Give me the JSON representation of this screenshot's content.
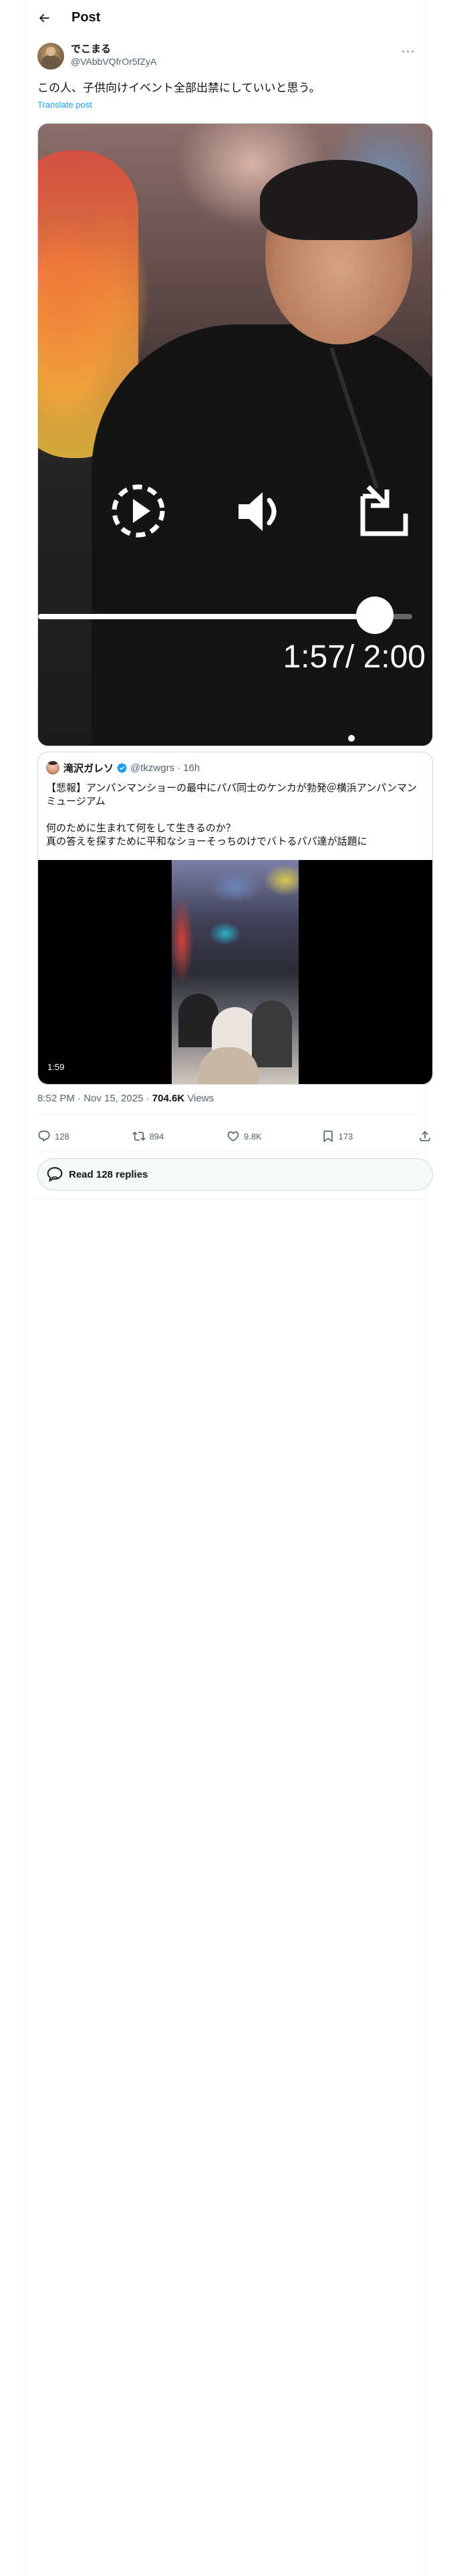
{
  "header": {
    "title": "Post",
    "back_icon": "arrow-left-icon"
  },
  "author": {
    "display_name": "でこまる",
    "handle": "@VAbbVQfrOr5fZyA",
    "more_label": "···"
  },
  "tweet": {
    "text": "この人、子供向けイベント全部出禁にしていいと思う。",
    "translate_label": "Translate post"
  },
  "video": {
    "controls": [
      "replay-icon",
      "volume-icon",
      "fullscreen-exit-icon"
    ],
    "progress": 0.9,
    "time_label": "1:57/ 2:00"
  },
  "quote": {
    "display_name": "滝沢ガレソ",
    "verified": true,
    "handle": "@tkzwgrs",
    "separator": "·",
    "time": "16h",
    "lines": [
      "【悲報】アンパンマンショーの最中にパパ同士のケンカが勃発＠横浜アンパンマンミュージアム",
      "",
      "何のために生まれて何をして生きるのか？",
      "真の答えを探すために平和なショーそっちのけでバトるパパ達が話題に"
    ],
    "video_duration": "1:59"
  },
  "meta": {
    "timestamp": "8:52 PM · Nov 15, 2025",
    "separator": " · ",
    "views_count": "704.6K",
    "views_label": " Views"
  },
  "actions": {
    "replies": "128",
    "reposts": "894",
    "likes": "9.8K",
    "bookmarks": "173"
  },
  "read_replies": {
    "label": "Read 128 replies"
  },
  "colors": {
    "accent": "#1d9bf0",
    "text": "#0f1419",
    "muted": "#536471",
    "border": "#cfd9de"
  }
}
